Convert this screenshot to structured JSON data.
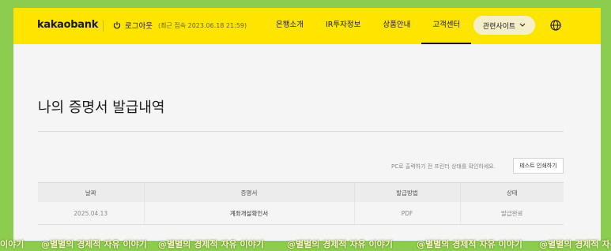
{
  "header": {
    "logo": "kakaobank",
    "logout_label": "로그아웃",
    "last_login": "(최근 접속 2023.06.18 21:59)",
    "nav": [
      "은행소개",
      "IR투자정보",
      "상품안내",
      "고객센터"
    ],
    "active_nav": "고객센터",
    "related_sites_label": "관련사이트",
    "icons": [
      "power-icon",
      "chevron-down-icon",
      "globe-icon"
    ],
    "colors": {
      "brand_yellow": "#fee500",
      "text": "#1a1a1a"
    }
  },
  "main": {
    "title": "나의 증명서 발급내역",
    "print_notice": "PC로 출력하기 전 프린터 상태를 확인하세요.",
    "test_print_label": "테스트 인쇄하기",
    "table": {
      "headers": [
        "날짜",
        "증명서",
        "발급방법",
        "상태"
      ],
      "rows": [
        [
          "2025.04.13",
          "계좌개설확인서",
          "PDF",
          "발급완료"
        ]
      ]
    }
  },
  "watermark": {
    "text": "@별별의 경제적 자유 이야기",
    "partial": "이야기"
  }
}
